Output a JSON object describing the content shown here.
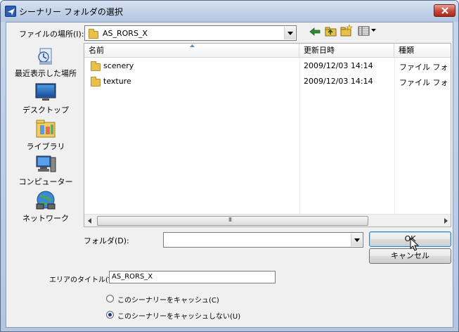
{
  "window": {
    "title": "シーナリー フォルダの選択"
  },
  "location": {
    "label": "ファイルの場所(I):",
    "value": "AS_RORS_X"
  },
  "places": [
    {
      "label": "最近表示した場所",
      "icon": "recent-places-icon"
    },
    {
      "label": "デスクトップ",
      "icon": "desktop-icon"
    },
    {
      "label": "ライブラリ",
      "icon": "libraries-icon"
    },
    {
      "label": "コンピューター",
      "icon": "computer-icon"
    },
    {
      "label": "ネットワーク",
      "icon": "network-icon"
    }
  ],
  "columns": [
    "名前",
    "更新日時",
    "種類"
  ],
  "files": [
    {
      "name": "scenery",
      "modified": "2009/12/03 14:14",
      "type": "ファイル フォ"
    },
    {
      "name": "texture",
      "modified": "2009/12/03 14:14",
      "type": "ファイル フォ"
    }
  ],
  "folder_field": {
    "label": "フォルダ(D):",
    "value": ""
  },
  "buttons": {
    "ok": "OK",
    "cancel": "キャンセル"
  },
  "area_title": {
    "label": "エリアのタイトル(T):",
    "value": "AS_RORS_X"
  },
  "cache_options": {
    "cache": "このシーナリーをキャッシュ(C)",
    "no_cache": "このシーナリーをキャッシュしない(U)",
    "selected": "no_cache"
  },
  "scrollbar_grip": "III",
  "colors": {
    "title_gradient": "#c2d2e8",
    "close": "#c4483a",
    "folder": "#e8c04a",
    "client": "#f0f0f0"
  }
}
